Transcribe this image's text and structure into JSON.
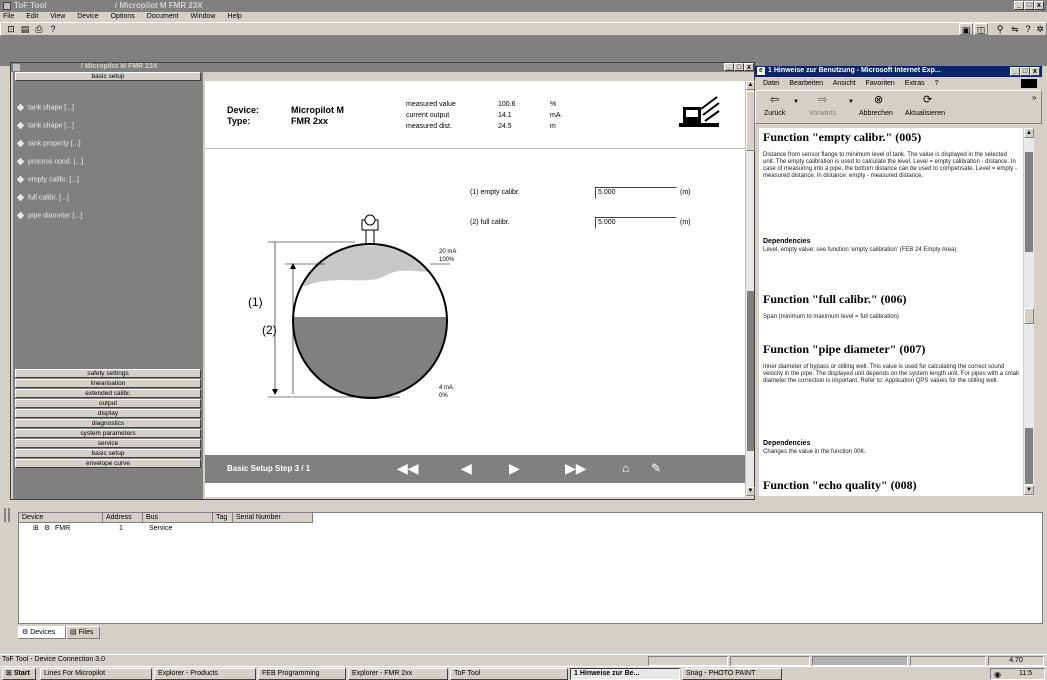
{
  "app": {
    "title": "ToF Tool",
    "subtitle": "/ Micropilot M FMR 23X",
    "menu": [
      "File",
      "Edit",
      "View",
      "Device",
      "Options",
      "Document",
      "Window",
      "Help"
    ]
  },
  "device_window": {
    "title": "/ Micropilot M FMR 23X",
    "basic_setup_label": "basic setup",
    "params": [
      "tank shape [...]",
      "tank shape [...]",
      "tank property [...]",
      "process cond. [...]",
      "empty calibr. [...]",
      "full calibr. [...]",
      "pipe diameter [...]"
    ],
    "groups": [
      "safety settings",
      "linearisation",
      "extended calibr.",
      "output",
      "display",
      "diagnostics",
      "system parameters",
      "service",
      "basic setup",
      "envelope curve"
    ]
  },
  "main": {
    "device_label": "Device:",
    "device_value": "Micropilot M",
    "type_label": "Type:",
    "type_value": "FMR 2xx",
    "measured": [
      {
        "label": "measured value",
        "value": "100.6",
        "unit": "%"
      },
      {
        "label": "current output",
        "value": "14.1",
        "unit": "mA"
      },
      {
        "label": "measured dist.",
        "value": "24.5",
        "unit": "m"
      }
    ],
    "empty_calibr_label": "(1) empty calibr.",
    "empty_calibr_value": "5.000",
    "empty_calibr_unit": "(m)",
    "full_calibr_label": "(2) full calibr.",
    "full_calibr_value": "5.000",
    "full_calibr_unit": "(m)",
    "diagram_label_1": "(1)",
    "diagram_label_2": "(2)",
    "top_ma": "20 mA",
    "top_pct": "100%",
    "bottom_ma": "4 mA",
    "bottom_pct": "0%",
    "step_label": "Basic Setup Step 3 / 1"
  },
  "help": {
    "title": "1 Hinweise zur Benutzung - Microsoft Internet Exp...",
    "menu": [
      "Datei",
      "Bearbeiten",
      "Ansicht",
      "Favoriten",
      "Extras",
      "?"
    ],
    "toolbar": [
      "Zurück",
      "Vorwärts",
      "Abbrechen",
      "Aktualisieren"
    ],
    "sections": [
      {
        "heading": "Function \"empty calibr.\" (005)",
        "text": "Distance from sensor flange to minimum level of tank. The value is displayed in the selected unit. The empty calibration is used to calculate the level. Level = empty calibration - distance. In case of measuring into a pipe, the bottom distance can be used to compensate. Level = empty - measured distance; in distance: empty - measured distance.",
        "sub": "Dependencies",
        "subtext": "Level, empty value; see function 'empty calibration' (FEB 24 Empty Area)"
      },
      {
        "heading": "Function \"full calibr.\" (006)",
        "text": "Span (minimum to maximum level = full calibration)"
      },
      {
        "heading": "Function \"pipe diameter\" (007)",
        "text": "Inner diameter of bypass or stilling well. This value is used for calculating the correct sound velocity in the pipe. The displayed unit depends on the system length unit. For pipes with a small diameter the correction is important. Refer to: Application QPS values for the stilling well.",
        "sub": "Dependencies",
        "subtext": "Changes the value in the function 008."
      },
      {
        "heading": "Function \"echo quality\" (008)"
      }
    ]
  },
  "bottom": {
    "columns": [
      "Device",
      "Address",
      "Bus",
      "Tag",
      "Serial Number"
    ],
    "rows": [
      {
        "device": "FMR",
        "address": "1",
        "bus": "Service",
        "tag": "",
        "serial": ""
      }
    ],
    "tabs": [
      "Devices",
      "Files"
    ]
  },
  "status": {
    "text": "ToF Tool - Device Connection 3.0",
    "right": "4.70"
  },
  "taskbar": {
    "start": "Start",
    "tasks": [
      "Lines For Micropilot",
      "Explorer - Products",
      "FEB Programming",
      "Explorer - FMR 2xx",
      "ToF Tool",
      "1 Hinweise zur Be...",
      "Snag - PHOTO PAINT"
    ],
    "clock": "11:5"
  }
}
